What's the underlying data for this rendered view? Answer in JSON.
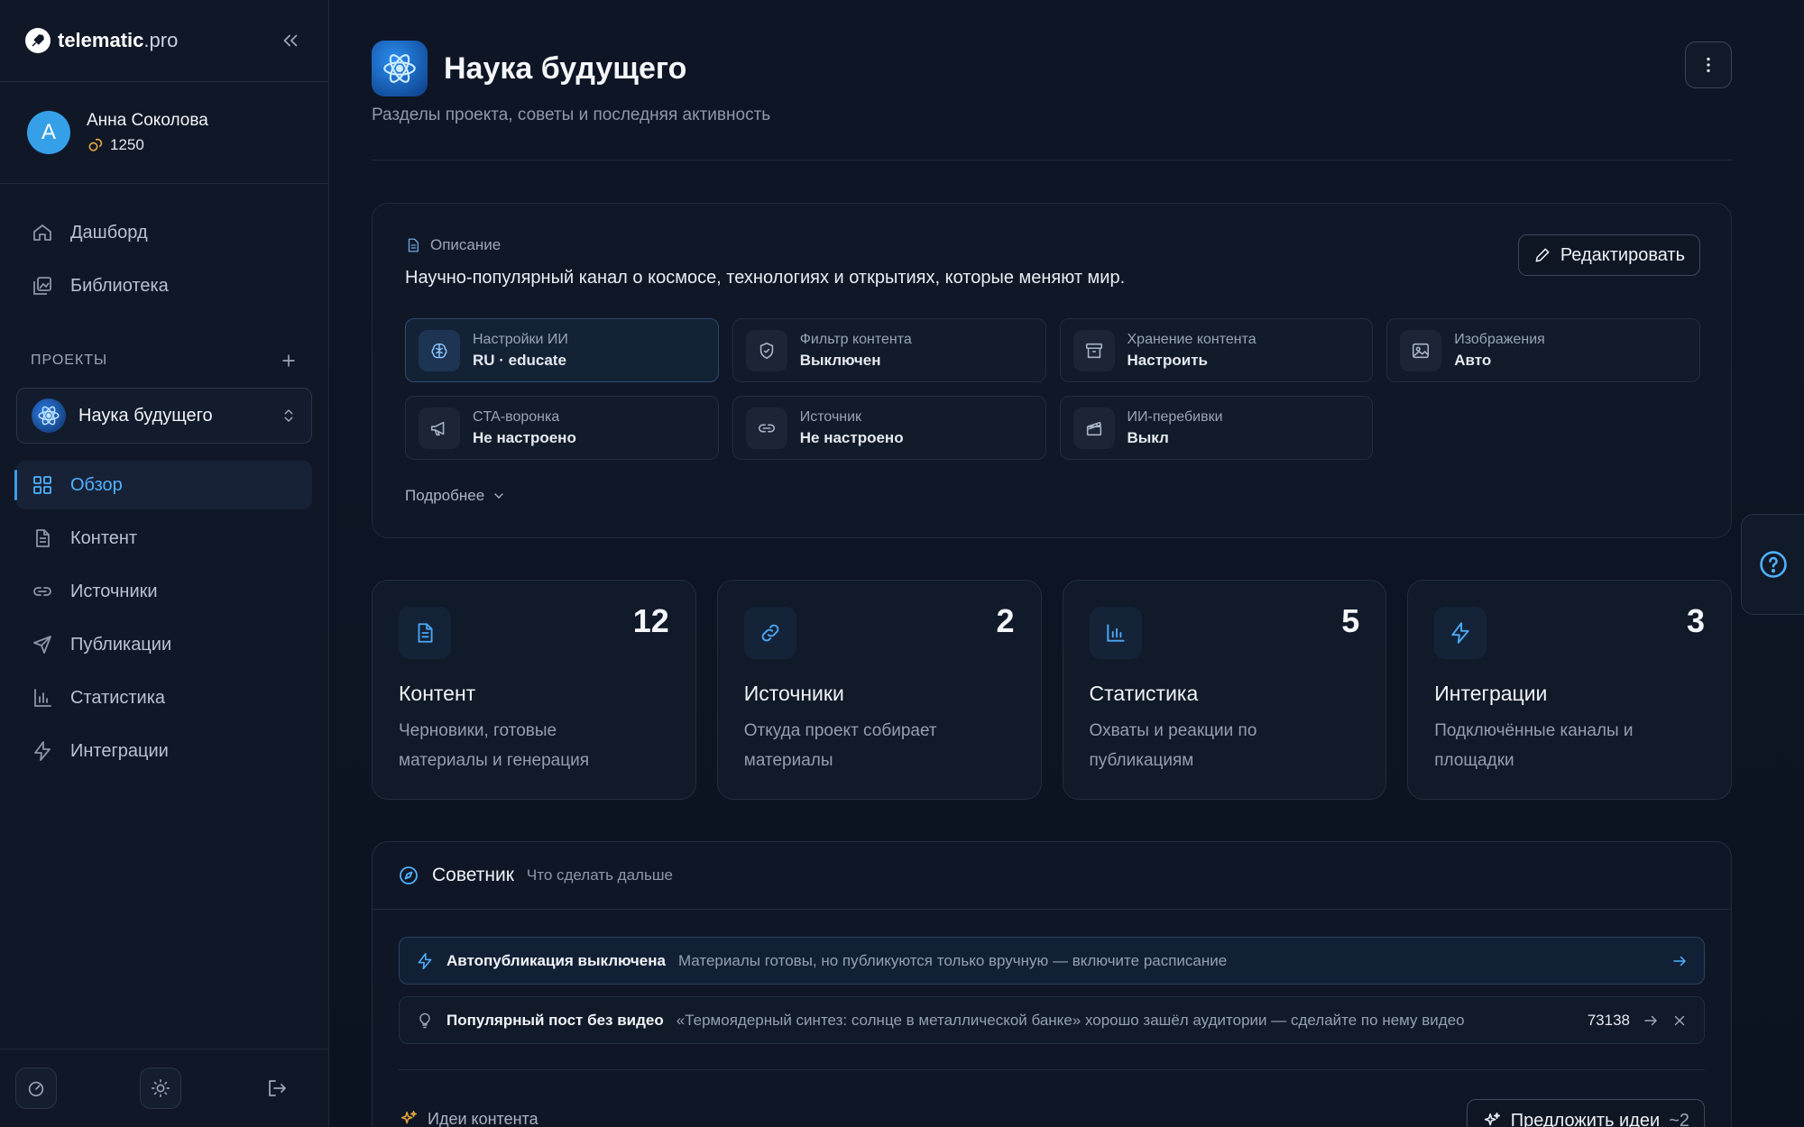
{
  "app": {
    "logo_bold": "telematic",
    "logo_light": ".pro"
  },
  "user": {
    "initial": "А",
    "name": "Анна Соколова",
    "credits": "1250"
  },
  "nav_top": [
    {
      "label": "Дашборд",
      "icon": "home-icon"
    },
    {
      "label": "Библиотека",
      "icon": "library-icon"
    }
  ],
  "projects": {
    "heading": "ПРОЕКТЫ",
    "selected": "Наука будущего"
  },
  "nav_project": [
    {
      "label": "Обзор",
      "icon": "grid-icon",
      "active": true
    },
    {
      "label": "Контент",
      "icon": "document-icon"
    },
    {
      "label": "Источники",
      "icon": "link-icon"
    },
    {
      "label": "Публикации",
      "icon": "send-icon"
    },
    {
      "label": "Статистика",
      "icon": "bar-chart-icon"
    },
    {
      "label": "Интеграции",
      "icon": "bolt-icon"
    }
  ],
  "page": {
    "title": "Наука будущего",
    "subtitle": "Разделы проекта, советы и последняя активность"
  },
  "description": {
    "label": "Описание",
    "text": "Научно-популярный канал о космосе, технологиях и открытиях, которые меняют мир.",
    "edit_label": "Редактировать",
    "more_label": "Подробнее"
  },
  "settings": [
    {
      "title": "Настройки ИИ",
      "value": "RU · educate",
      "icon": "brain-icon"
    },
    {
      "title": "Фильтр контента",
      "value": "Выключен",
      "icon": "shield-icon"
    },
    {
      "title": "Хранение контента",
      "value": "Настроить",
      "icon": "archive-icon"
    },
    {
      "title": "Изображения",
      "value": "Авто",
      "icon": "image-icon"
    },
    {
      "title": "CTA-воронка",
      "value": "Не настроено",
      "icon": "megaphone-icon"
    },
    {
      "title": "Источник",
      "value": "Не настроено",
      "icon": "link-icon"
    },
    {
      "title": "ИИ-перебивки",
      "value": "Выкл",
      "icon": "clapper-icon"
    }
  ],
  "stats": [
    {
      "title": "Контент",
      "count": "12",
      "desc": "Черновики, готовые материалы и генерация",
      "icon": "document-icon"
    },
    {
      "title": "Источники",
      "count": "2",
      "desc": "Откуда проект собирает материалы",
      "icon": "link-icon"
    },
    {
      "title": "Статистика",
      "count": "5",
      "desc": "Охваты и реакции по публикациям",
      "icon": "bar-chart-icon"
    },
    {
      "title": "Интеграции",
      "count": "3",
      "desc": "Подключённые каналы и площадки",
      "icon": "bolt-icon"
    }
  ],
  "advisor": {
    "title": "Советник",
    "subtitle": "Что сделать дальше",
    "tips": [
      {
        "title": "Автопубликация выключена",
        "text": "Материалы готовы, но публикуются только вручную — включите расписание",
        "icon": "bolt-icon"
      },
      {
        "title": "Популярный пост без видео",
        "text": "«Термоядерный синтез: солнце в металлической банке» хорошо зашёл аудитории — сделайте по нему видео",
        "count": "73138",
        "icon": "bulb-icon"
      }
    ],
    "ideas_label": "Идеи контента",
    "suggest_label": "Предложить идеи",
    "suggest_estimate": "~2"
  },
  "colors": {
    "accent": "#4fb2ff",
    "background": "#0c1320",
    "sidebar": "#101828"
  }
}
